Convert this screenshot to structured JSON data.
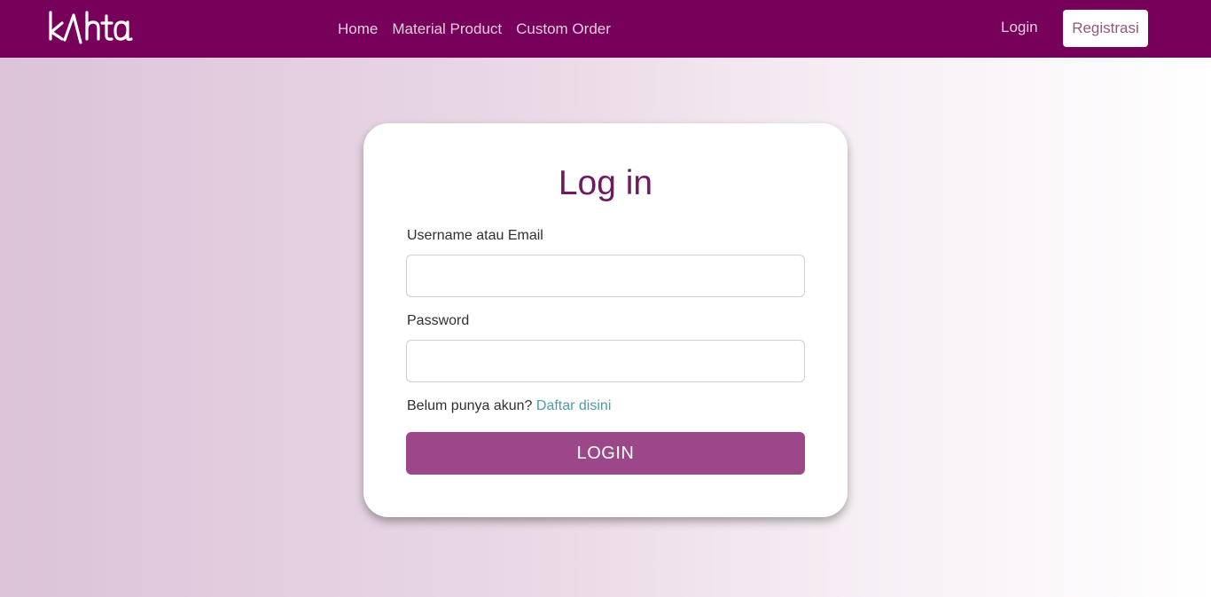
{
  "nav": {
    "logo_text": "kAhta",
    "links": [
      "Home",
      "Material Product",
      "Custom Order"
    ],
    "login_label": "Login",
    "register_label": "Registrasi"
  },
  "form": {
    "title": "Log in",
    "username_label": "Username atau Email",
    "username_value": "",
    "password_label": "Password",
    "password_value": "",
    "signup_prompt": "Belum punya akun?",
    "signup_link": "Daftar disini",
    "submit_label": "LOGIN"
  },
  "colors": {
    "navbar_bg": "#77005a",
    "title_color": "#6f1a5f",
    "button_bg": "#9b478a",
    "link_color": "#4f9aa9"
  }
}
